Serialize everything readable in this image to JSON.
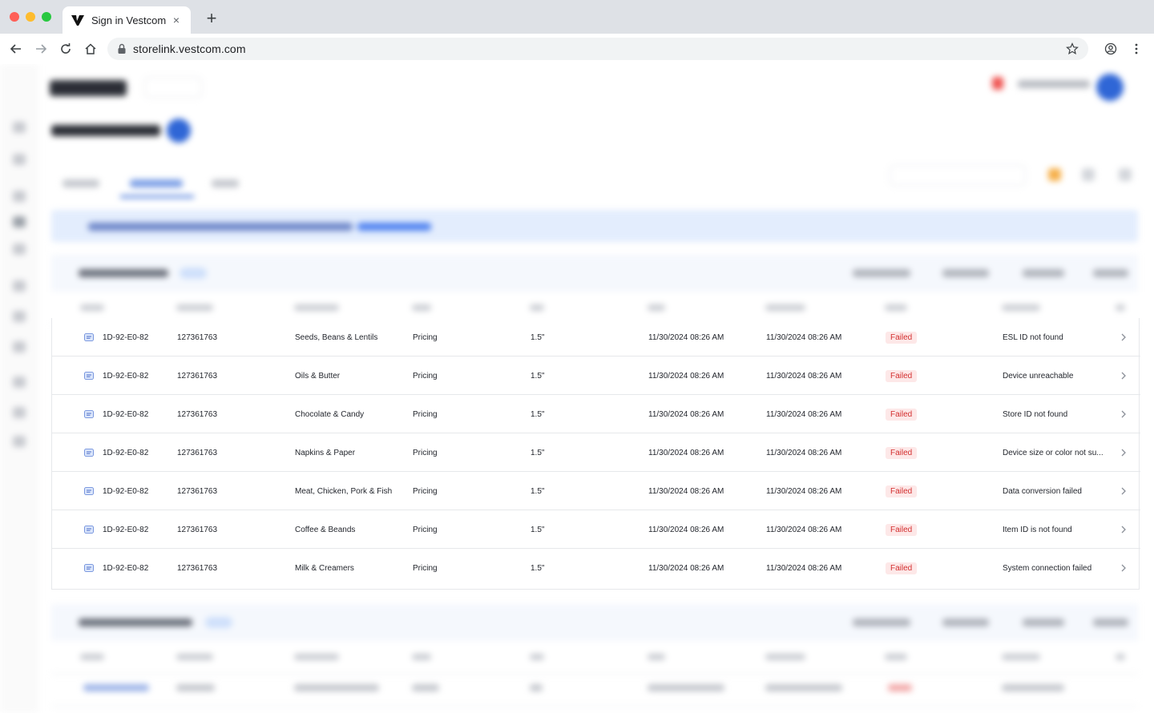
{
  "browser": {
    "tab_title": "Sign in Vestcom",
    "new_tab_label": "+",
    "tab_close": "×",
    "url": "storelink.vestcom.com"
  },
  "colors": {
    "accent": "#2f66d6",
    "failed_bg": "#fde8e8",
    "failed_text": "#d32f2f",
    "banner_bg": "#e3edfd"
  },
  "table": {
    "rows": [
      {
        "device_id": "1D-92-E0-82",
        "item_id": "127361763",
        "category": "Seeds, Beans & Lentils",
        "type": "Pricing",
        "size": "1.5\"",
        "date1": "11/30/2024 08:26 AM",
        "date2": "11/30/2024 08:26 AM",
        "status": "Failed",
        "reason": "ESL ID not found"
      },
      {
        "device_id": "1D-92-E0-82",
        "item_id": "127361763",
        "category": "Oils & Butter",
        "type": "Pricing",
        "size": "1.5\"",
        "date1": "11/30/2024 08:26 AM",
        "date2": "11/30/2024 08:26 AM",
        "status": "Failed",
        "reason": "Device unreachable"
      },
      {
        "device_id": "1D-92-E0-82",
        "item_id": "127361763",
        "category": "Chocolate & Candy",
        "type": "Pricing",
        "size": "1.5\"",
        "date1": "11/30/2024 08:26 AM",
        "date2": "11/30/2024 08:26 AM",
        "status": "Failed",
        "reason": "Store ID not found"
      },
      {
        "device_id": "1D-92-E0-82",
        "item_id": "127361763",
        "category": "Napkins & Paper",
        "type": "Pricing",
        "size": "1.5\"",
        "date1": "11/30/2024 08:26 AM",
        "date2": "11/30/2024 08:26 AM",
        "status": "Failed",
        "reason": "Device size or color not su..."
      },
      {
        "device_id": "1D-92-E0-82",
        "item_id": "127361763",
        "category": "Meat, Chicken, Pork & Fish",
        "type": "Pricing",
        "size": "1.5\"",
        "date1": "11/30/2024 08:26 AM",
        "date2": "11/30/2024 08:26 AM",
        "status": "Failed",
        "reason": "Data conversion failed"
      },
      {
        "device_id": "1D-92-E0-82",
        "item_id": "127361763",
        "category": "Coffee & Beands",
        "type": "Pricing",
        "size": "1.5\"",
        "date1": "11/30/2024 08:26 AM",
        "date2": "11/30/2024 08:26 AM",
        "status": "Failed",
        "reason": "Item ID is not found"
      },
      {
        "device_id": "1D-92-E0-82",
        "item_id": "127361763",
        "category": "Milk & Creamers",
        "type": "Pricing",
        "size": "1.5\"",
        "date1": "11/30/2024 08:26 AM",
        "date2": "11/30/2024 08:26 AM",
        "status": "Failed",
        "reason": "System connection failed"
      }
    ],
    "chevron": "›"
  }
}
